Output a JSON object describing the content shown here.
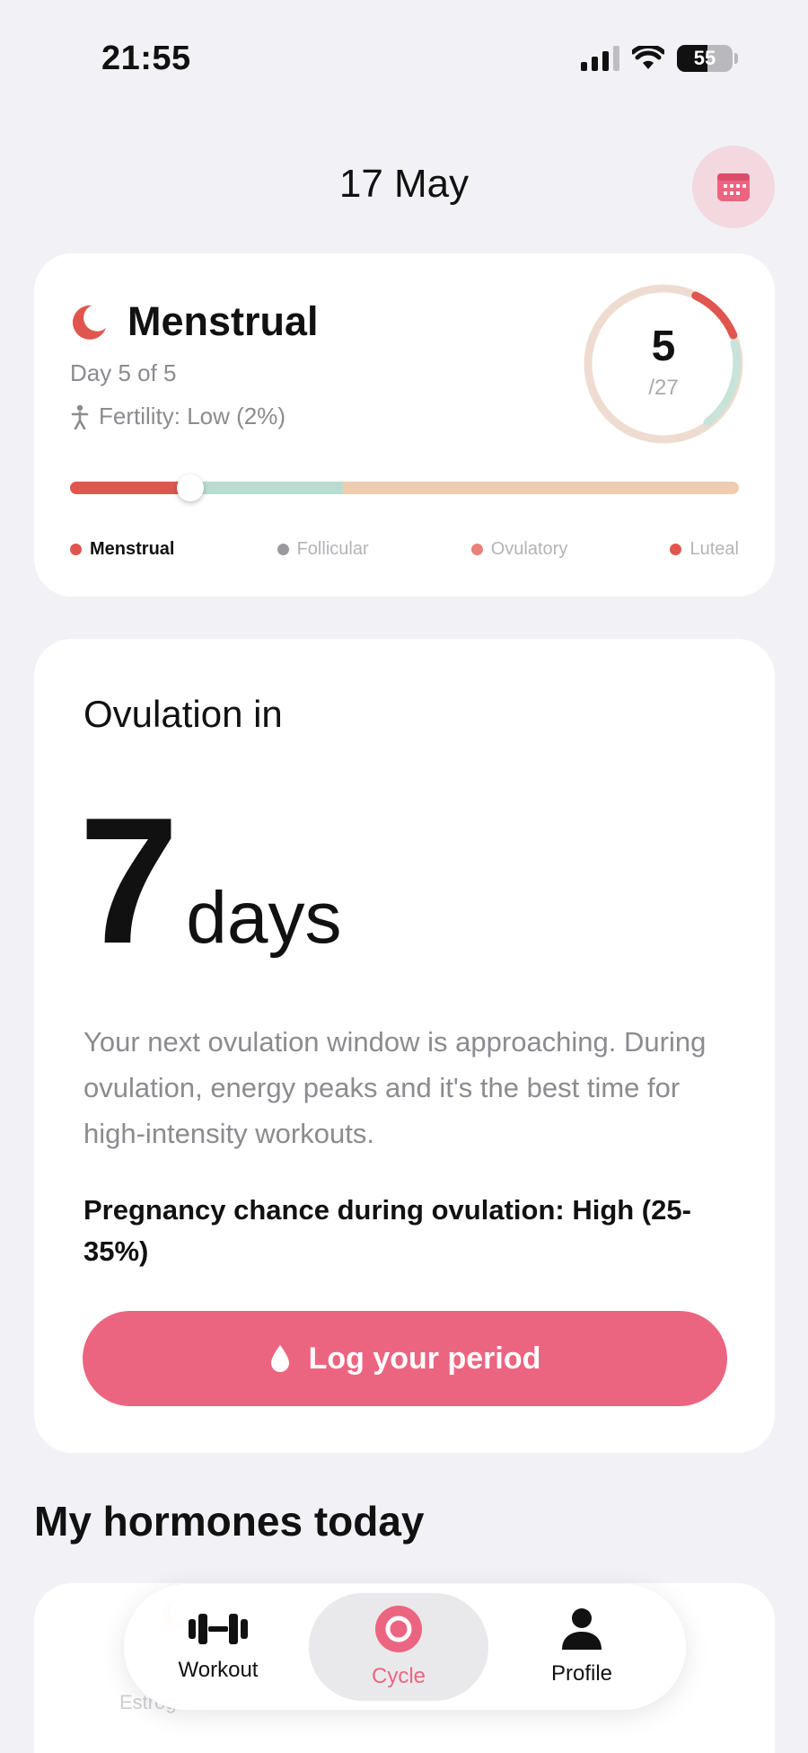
{
  "status_bar": {
    "time": "21:55",
    "battery": "55"
  },
  "header": {
    "date": "17 May"
  },
  "phase": {
    "title": "Menstrual",
    "day_text": "Day 5 of 5",
    "fertility": "Fertility: Low (2%)",
    "cycle_day": "5",
    "cycle_length": "/27"
  },
  "legend": [
    {
      "label": "Menstrual",
      "color": "#e0564f"
    },
    {
      "label": "Follicular",
      "color": "#9a9a9e"
    },
    {
      "label": "Ovulatory",
      "color": "#e0564f"
    },
    {
      "label": "Luteal",
      "color": "#e0564f"
    }
  ],
  "ovulation": {
    "heading": "Ovulation in",
    "days": "7",
    "unit": "days",
    "description": "Your next ovulation window is approaching. During ovulation, energy peaks and it's the best time for high-intensity workouts.",
    "chance": "Pregnancy chance during ovulation: High (25-35%)",
    "log_button": "Log your period"
  },
  "hormones": {
    "title": "My hormones today",
    "first_label": "Estrog"
  },
  "tabs": [
    {
      "label": "Workout",
      "icon": "dumbbell-icon"
    },
    {
      "label": "Cycle",
      "icon": "cycle-icon"
    },
    {
      "label": "Profile",
      "icon": "person-icon"
    }
  ],
  "colors": {
    "accent": "#ec6580",
    "menstrual": "#e0564f",
    "follicular": "#b8dcd0",
    "luteal": "#efccb0"
  }
}
